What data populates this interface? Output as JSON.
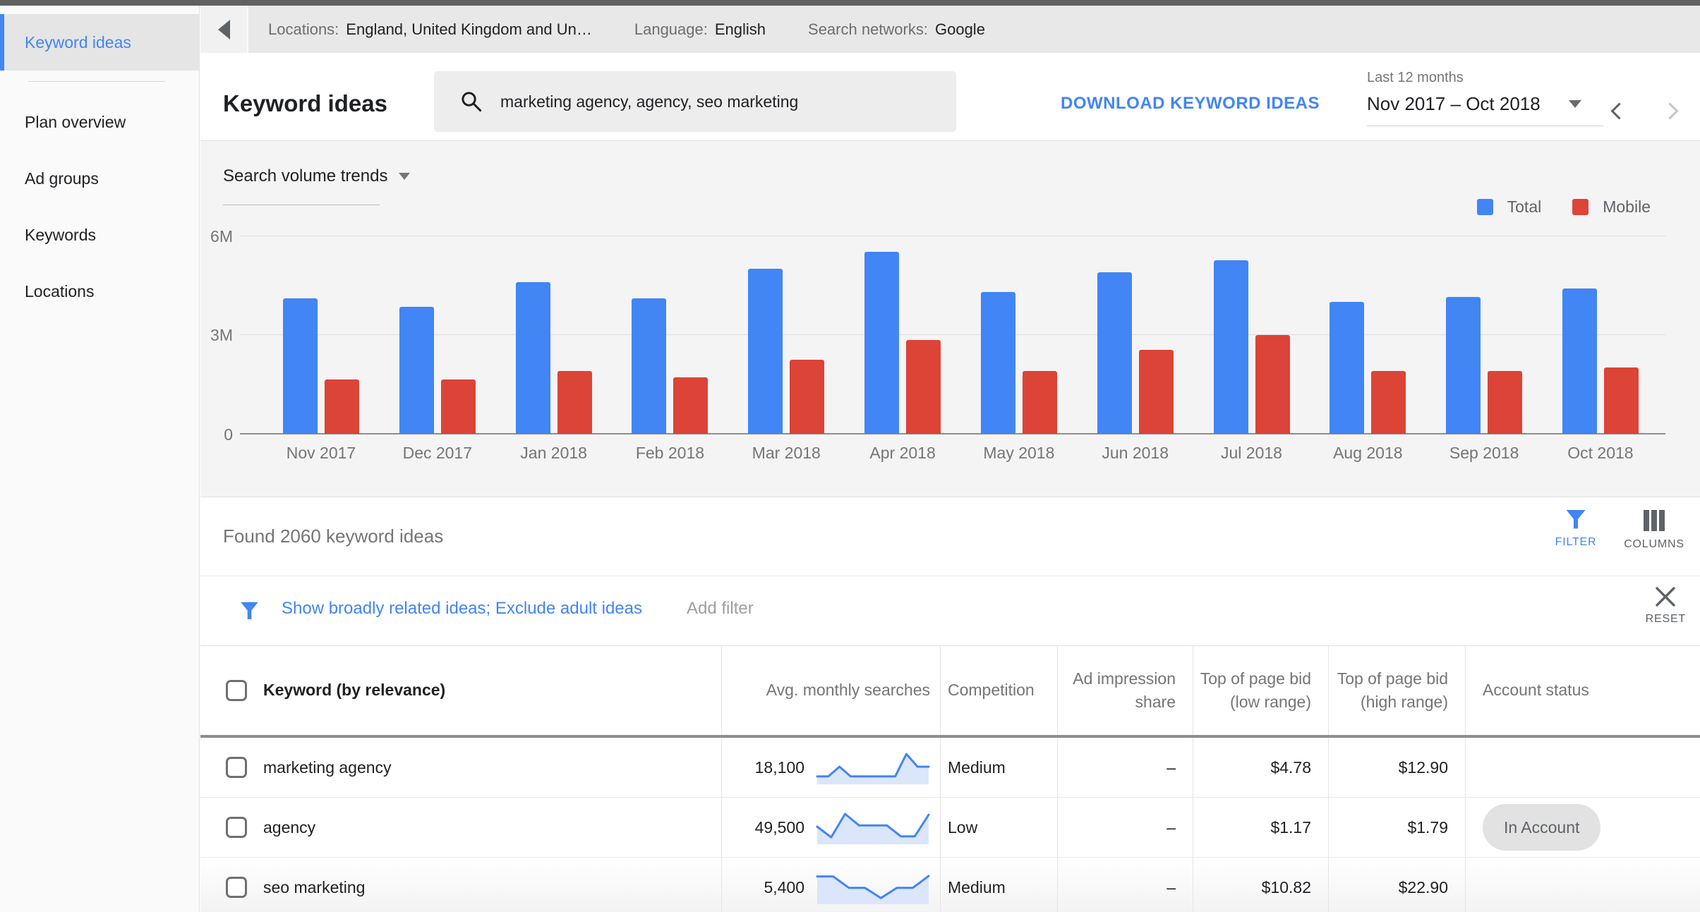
{
  "colors": {
    "accent": "#4285f4",
    "total": "#4285f4",
    "mobile": "#db4437",
    "sparkline_fill": "#dbe6fa"
  },
  "sidebar": {
    "items": [
      {
        "label": "Keyword ideas",
        "selected": true
      },
      {
        "label": "Plan overview",
        "selected": false
      },
      {
        "label": "Ad groups",
        "selected": false
      },
      {
        "label": "Keywords",
        "selected": false
      },
      {
        "label": "Locations",
        "selected": false
      }
    ]
  },
  "info_bar": {
    "locations_label": "Locations:",
    "locations_value": "England, United Kingdom and Un…",
    "language_label": "Language:",
    "language_value": "English",
    "networks_label": "Search networks:",
    "networks_value": "Google"
  },
  "header": {
    "title": "Keyword ideas",
    "search_value": "marketing agency, agency, seo marketing",
    "download_label": "DOWNLOAD KEYWORD IDEAS",
    "range_label": "Last 12 months",
    "range_value": "Nov 2017 – Oct 2018"
  },
  "chart_data": {
    "type": "bar",
    "title": "Search volume trends",
    "categories": [
      "Nov 2017",
      "Dec 2017",
      "Jan 2018",
      "Feb 2018",
      "Mar 2018",
      "Apr 2018",
      "May 2018",
      "Jun 2018",
      "Jul 2018",
      "Aug 2018",
      "Sep 2018",
      "Oct 2018"
    ],
    "series": [
      {
        "name": "Total",
        "color": "#4285f4",
        "values": [
          4100000,
          3850000,
          4600000,
          4100000,
          5000000,
          5500000,
          4300000,
          4900000,
          5250000,
          4000000,
          4150000,
          4400000
        ]
      },
      {
        "name": "Mobile",
        "color": "#db4437",
        "values": [
          1650000,
          1650000,
          1900000,
          1700000,
          2250000,
          2850000,
          1900000,
          2550000,
          3000000,
          1900000,
          1900000,
          2000000
        ]
      }
    ],
    "ylim": [
      0,
      6000000
    ],
    "yticks": [
      "6M",
      "3M",
      "0"
    ],
    "xlabel": "",
    "ylabel": "",
    "grid": "horizontal",
    "legend_position": "top-right"
  },
  "results": {
    "found_text": "Found 2060 keyword ideas",
    "filter_label": "FILTER",
    "columns_label": "COLUMNS"
  },
  "filter_bar": {
    "active_filters": "Show broadly related ideas; Exclude adult ideas",
    "add_filter": "Add filter",
    "reset_label": "RESET"
  },
  "table": {
    "columns": [
      "Keyword (by relevance)",
      "Avg. monthly searches",
      "Competition",
      "Ad impression share",
      "Top of page bid (low range)",
      "Top of page bid (high range)",
      "Account status"
    ],
    "rows": [
      {
        "keyword": "marketing agency",
        "avg_monthly_searches": "18,100",
        "trend": [
          0.12,
          0.12,
          0.5,
          0.12,
          0.12,
          0.12,
          0.12,
          0.12,
          1.0,
          0.5,
          0.5
        ],
        "competition": "Medium",
        "ad_impression_share": "–",
        "top_of_page_bid_low": "$4.78",
        "top_of_page_bid_high": "$12.90",
        "account_status": ""
      },
      {
        "keyword": "agency",
        "avg_monthly_searches": "49,500",
        "trend": [
          0.5,
          0.08,
          1.0,
          0.55,
          0.55,
          0.55,
          0.12,
          0.12,
          0.97
        ],
        "competition": "Low",
        "ad_impression_share": "–",
        "top_of_page_bid_low": "$1.17",
        "top_of_page_bid_high": "$1.79",
        "account_status": "In Account"
      },
      {
        "keyword": "seo marketing",
        "avg_monthly_searches": "5,400",
        "trend": [
          0.9,
          0.9,
          0.45,
          0.45,
          0.05,
          0.45,
          0.45,
          0.92
        ],
        "competition": "Medium",
        "ad_impression_share": "–",
        "top_of_page_bid_low": "$10.82",
        "top_of_page_bid_high": "$22.90",
        "account_status": ""
      }
    ]
  }
}
